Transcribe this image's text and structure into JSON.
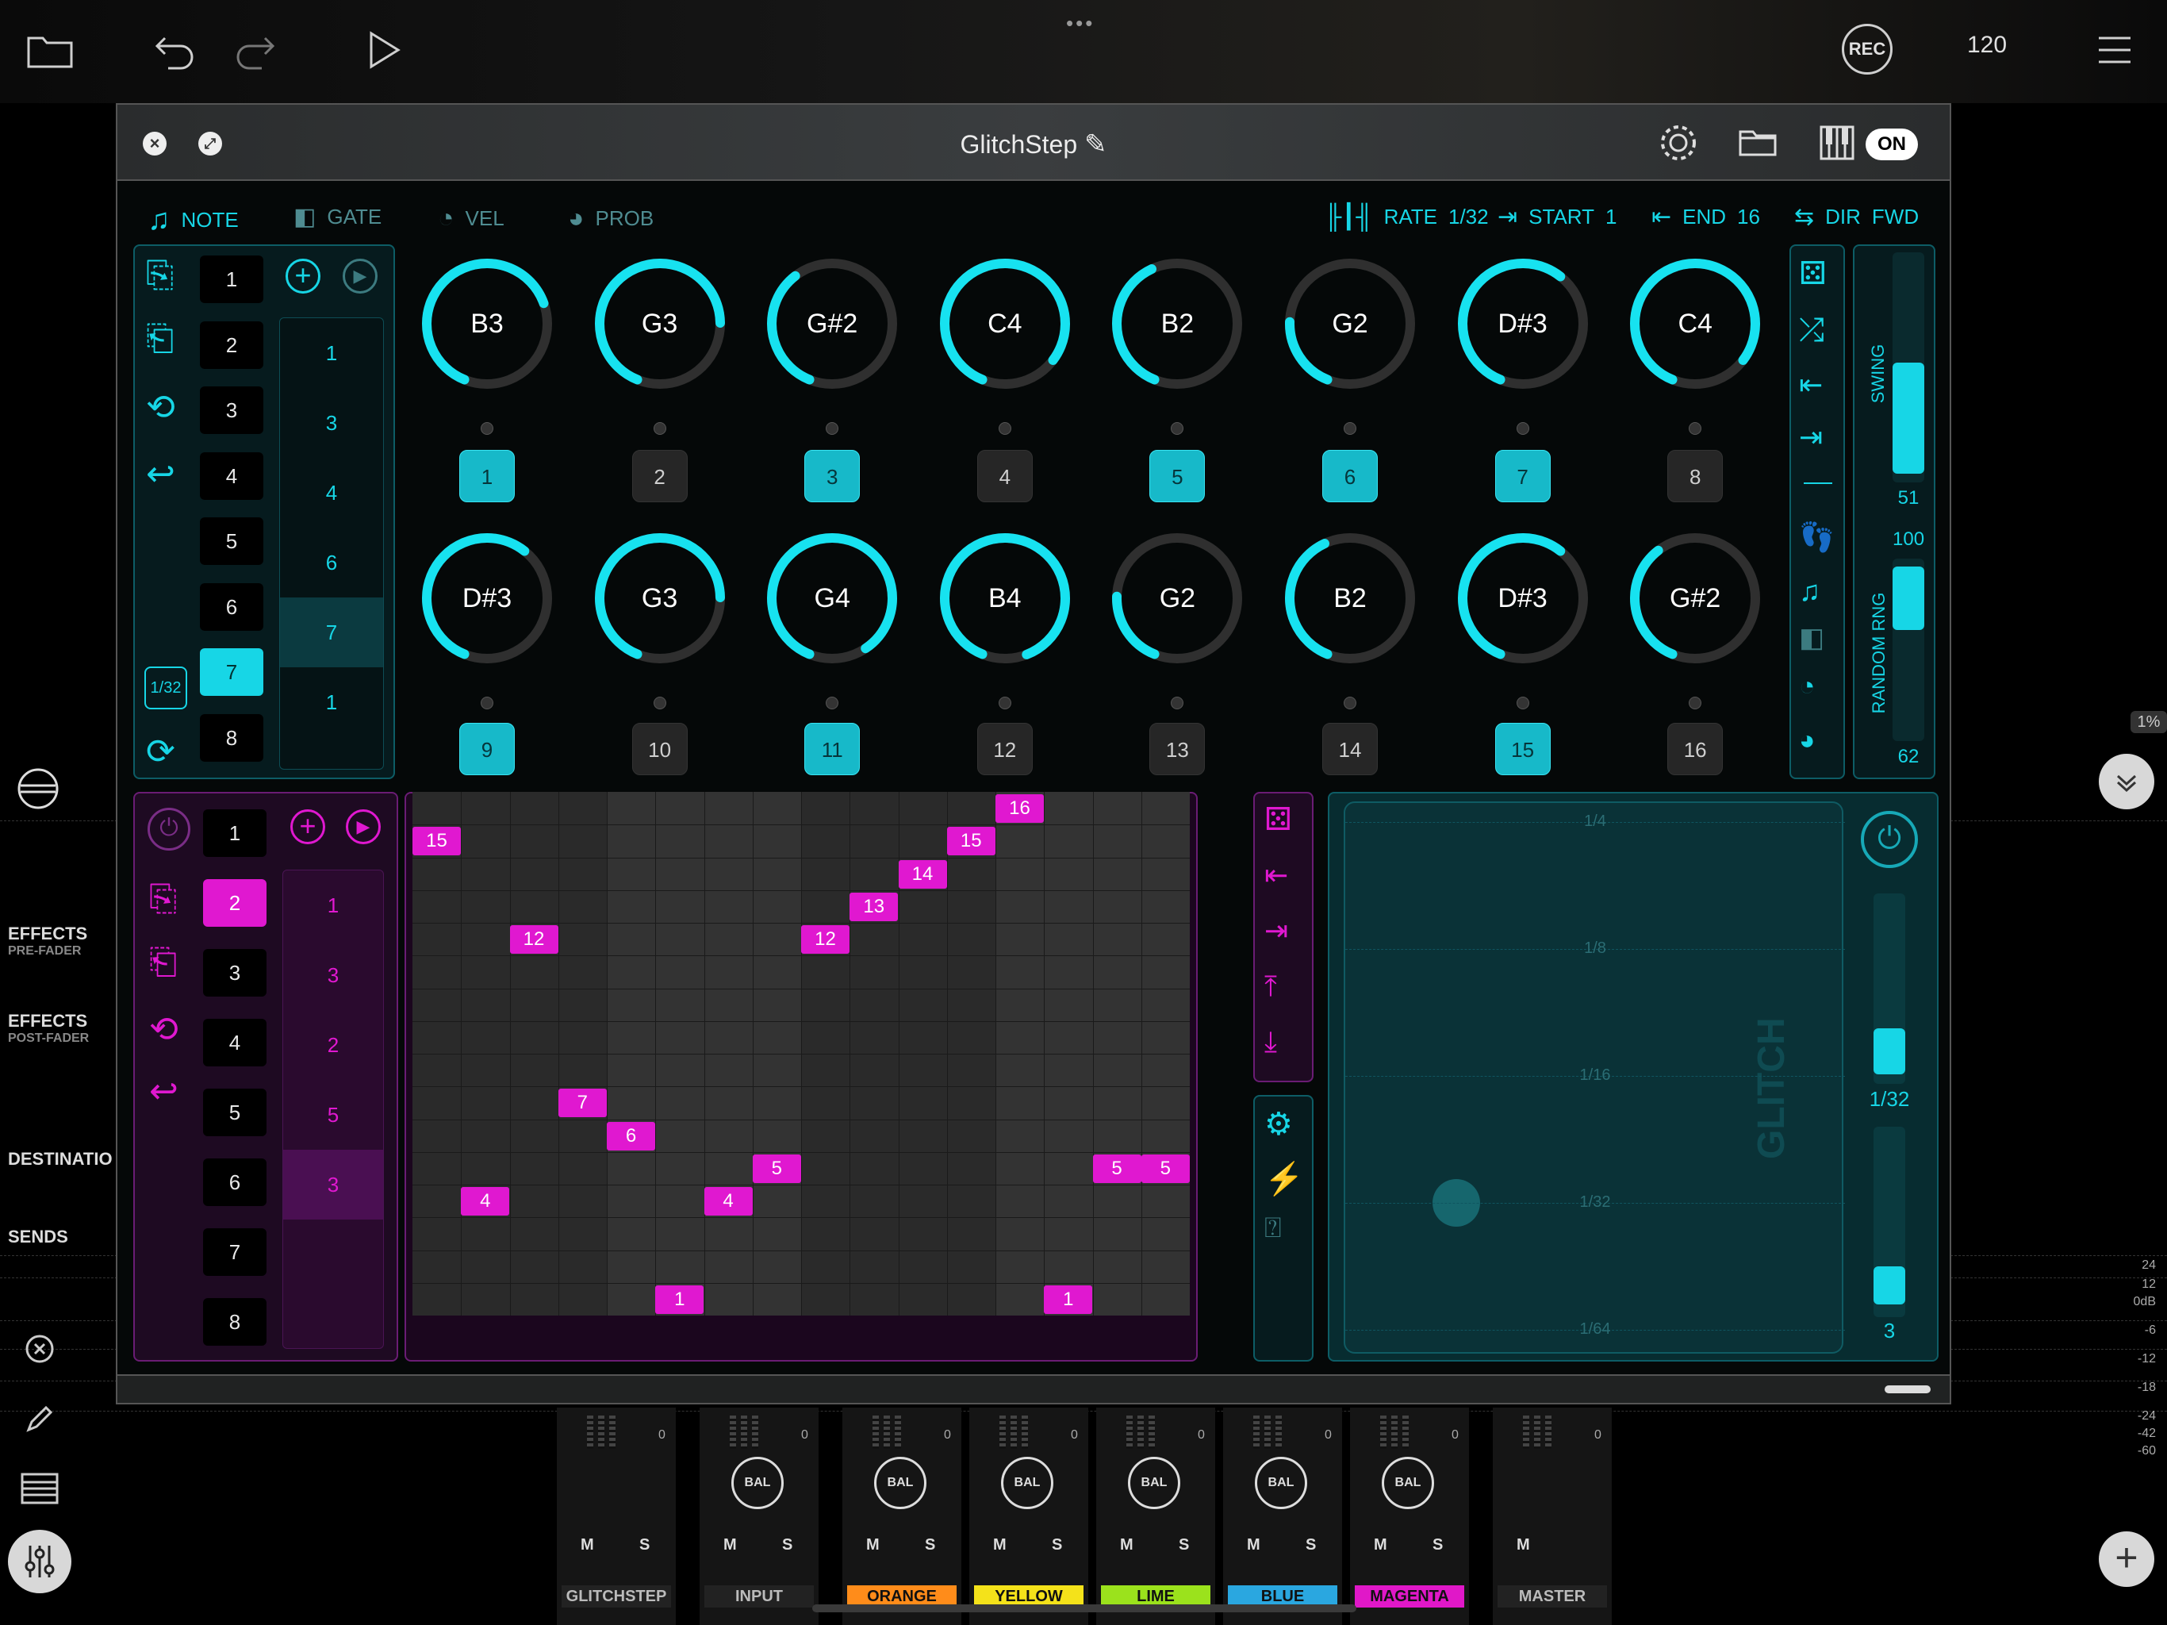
{
  "topbar": {
    "rec_label": "REC",
    "tempo": "120"
  },
  "window": {
    "title": "GlitchStep",
    "on_label": "ON"
  },
  "tabs": [
    {
      "label": "NOTE"
    },
    {
      "label": "GATE"
    },
    {
      "label": "VEL"
    },
    {
      "label": "PROB"
    }
  ],
  "transport": {
    "rate_label": "RATE",
    "rate_value": "1/32",
    "start_label": "START",
    "start_value": "1",
    "end_label": "END",
    "end_value": "16",
    "dir_label": "DIR",
    "dir_value": "FWD"
  },
  "cyan_panel": {
    "numbers": [
      "1",
      "2",
      "3",
      "4",
      "5",
      "6",
      "7",
      "8"
    ],
    "active": "7",
    "rate_badge": "1/32",
    "sequence": [
      "1",
      "3",
      "4",
      "6",
      "7",
      "1"
    ]
  },
  "knobs_row1": [
    {
      "note": "B3",
      "level": 0.72
    },
    {
      "note": "G3",
      "level": 0.78
    },
    {
      "note": "G#2",
      "level": 0.38
    },
    {
      "note": "C4",
      "level": 0.9
    },
    {
      "note": "B2",
      "level": 0.42
    },
    {
      "note": "G2",
      "level": 0.22
    },
    {
      "note": "D#3",
      "level": 0.62
    },
    {
      "note": "C4",
      "level": 0.9
    }
  ],
  "knobs_row2": [
    {
      "note": "D#3",
      "level": 0.62
    },
    {
      "note": "G3",
      "level": 0.78
    },
    {
      "note": "G4",
      "level": 0.96
    },
    {
      "note": "B4",
      "level": 1.0
    },
    {
      "note": "G2",
      "level": 0.22
    },
    {
      "note": "B2",
      "level": 0.42
    },
    {
      "note": "D#3",
      "level": 0.62
    },
    {
      "note": "G#2",
      "level": 0.38
    }
  ],
  "steps_row1": [
    {
      "n": "1",
      "on": true
    },
    {
      "n": "2",
      "on": false
    },
    {
      "n": "3",
      "on": true
    },
    {
      "n": "4",
      "on": false
    },
    {
      "n": "5",
      "on": true
    },
    {
      "n": "6",
      "on": true
    },
    {
      "n": "7",
      "on": true
    },
    {
      "n": "8",
      "on": false
    }
  ],
  "steps_row2": [
    {
      "n": "9",
      "on": true
    },
    {
      "n": "10",
      "on": false
    },
    {
      "n": "11",
      "on": true
    },
    {
      "n": "12",
      "on": false
    },
    {
      "n": "13",
      "on": false
    },
    {
      "n": "14",
      "on": false
    },
    {
      "n": "15",
      "on": true
    },
    {
      "n": "16",
      "on": false
    }
  ],
  "swing": {
    "label": "SWING",
    "value": "51",
    "level": 0.51
  },
  "random_rng": {
    "label": "RANDOM RNG",
    "max": "100",
    "value": "62"
  },
  "magenta_panel": {
    "numbers": [
      "1",
      "2",
      "3",
      "4",
      "5",
      "6",
      "7",
      "8"
    ],
    "active": "2",
    "sequence": [
      "1",
      "3",
      "2",
      "5",
      "3"
    ]
  },
  "note_grid": [
    {
      "col": 0,
      "row": 1,
      "label": "15"
    },
    {
      "col": 1,
      "row": 12,
      "label": "4"
    },
    {
      "col": 2,
      "row": 4,
      "label": "12"
    },
    {
      "col": 3,
      "row": 9,
      "label": "7"
    },
    {
      "col": 4,
      "row": 10,
      "label": "6"
    },
    {
      "col": 5,
      "row": 15,
      "label": "1"
    },
    {
      "col": 6,
      "row": 12,
      "label": "4"
    },
    {
      "col": 7,
      "row": 11,
      "label": "5"
    },
    {
      "col": 8,
      "row": 4,
      "label": "12"
    },
    {
      "col": 9,
      "row": 3,
      "label": "13"
    },
    {
      "col": 10,
      "row": 2,
      "label": "14"
    },
    {
      "col": 11,
      "row": 1,
      "label": "15"
    },
    {
      "col": 12,
      "row": 0,
      "label": "16"
    },
    {
      "col": 13,
      "row": 15,
      "label": "1"
    },
    {
      "col": 14,
      "row": 11,
      "label": "5"
    },
    {
      "col": 15,
      "row": 11,
      "label": "5"
    }
  ],
  "glitch": {
    "watermark": "GLITCH",
    "rates": [
      "1/4",
      "1/8",
      "1/16",
      "1/32",
      "1/64"
    ],
    "slider1_value": "1/32",
    "slider2_value": "3"
  },
  "left_sidebar": {
    "effects_pre": "EFFECTS",
    "effects_pre_sub": "PRE-FADER",
    "effects_post": "EFFECTS",
    "effects_post_sub": "POST-FADER",
    "destination": "DESTINATIO",
    "sends": "SENDS"
  },
  "percent_badge": "1%",
  "db_scale": [
    "24",
    "12",
    "0dB",
    "-6",
    "-12",
    "-18",
    "-24",
    "-42",
    "-60"
  ],
  "channels": [
    {
      "name": "GLITCHSTEP",
      "color": "#222",
      "text": "#bbb",
      "bal": false,
      "solo": true,
      "meter": "0"
    },
    {
      "name": "INPUT",
      "color": "#222",
      "text": "#bbb",
      "bal": true,
      "solo": true,
      "meter": "0"
    },
    {
      "name": "ORANGE",
      "color": "#ff8c1a",
      "text": "#111",
      "bal": true,
      "solo": true,
      "meter": "0"
    },
    {
      "name": "YELLOW",
      "color": "#f4e21a",
      "text": "#111",
      "bal": true,
      "solo": true,
      "meter": "0"
    },
    {
      "name": "LIME",
      "color": "#9be21c",
      "text": "#111",
      "bal": true,
      "solo": true,
      "meter": "0"
    },
    {
      "name": "BLUE",
      "color": "#2aa7e0",
      "text": "#111",
      "bal": true,
      "solo": true,
      "meter": "0"
    },
    {
      "name": "MAGENTA",
      "color": "#e018c8",
      "text": "#111",
      "bal": true,
      "solo": true,
      "meter": "0"
    },
    {
      "name": "MASTER",
      "color": "#222",
      "text": "#bbb",
      "bal": false,
      "solo": false,
      "meter": "0"
    }
  ],
  "mute_label": "M",
  "solo_label": "S",
  "bal_label": "BAL",
  "colors": {
    "cyan": "#17d6e6",
    "magenta": "#e018d0"
  }
}
